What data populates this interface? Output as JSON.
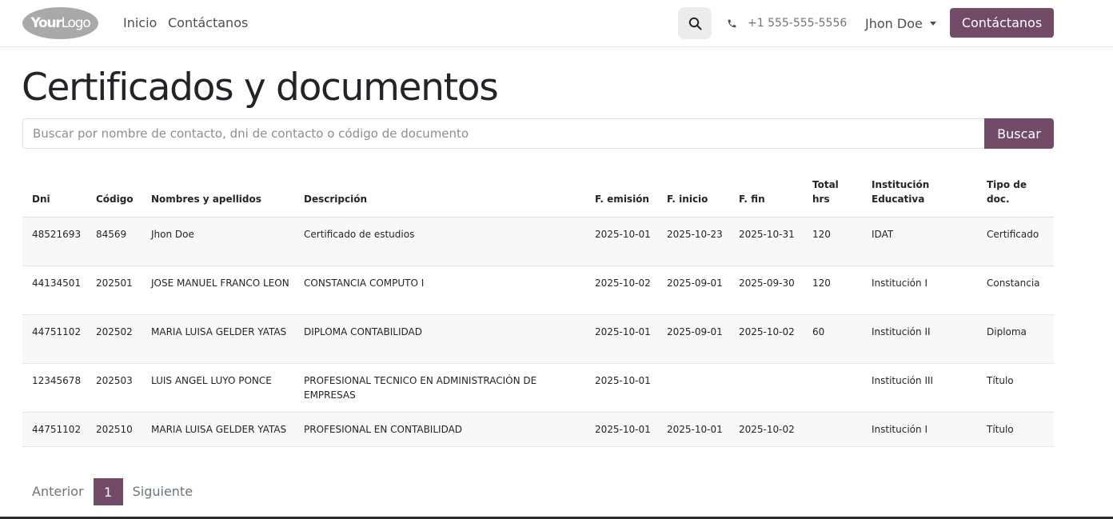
{
  "header": {
    "logo": {
      "text_bold": "Your",
      "text_light": "Logo"
    },
    "nav": {
      "home": "Inicio",
      "contact": "Contáctanos"
    },
    "search_icon": "search-icon",
    "phone": {
      "icon": "phone-icon",
      "number": "+1 555-555-5556"
    },
    "user_name": "Jhon Doe",
    "cta_label": "Contáctanos"
  },
  "page": {
    "title": "Certificados y documentos"
  },
  "search": {
    "placeholder": "Buscar por nombre de contacto, dni de contacto o código de documento",
    "button_label": "Buscar"
  },
  "table": {
    "headers": {
      "dni": "Dni",
      "codigo": "Código",
      "nombres": "Nombres y apellidos",
      "descripcion": "Descripción",
      "f_emision": "F. emisión",
      "f_inicio": "F. inicio",
      "f_fin": "F. fin",
      "total_hrs": "Total hrs",
      "institucion": "Institución Educativa",
      "tipo_doc": "Tipo de doc."
    },
    "rows": [
      {
        "dni": "48521693",
        "codigo": "84569",
        "nombres": "Jhon Doe",
        "descripcion": "Certificado de estudios",
        "f_emision": "2025-10-01",
        "f_inicio": "2025-10-23",
        "f_fin": "2025-10-31",
        "total_hrs": "120",
        "institucion": "IDAT",
        "tipo_doc": "Certificado"
      },
      {
        "dni": "44134501",
        "codigo": "202501",
        "nombres": "JOSE MANUEL FRANCO LEON",
        "descripcion": "CONSTANCIA COMPUTO I",
        "f_emision": "2025-10-02",
        "f_inicio": "2025-09-01",
        "f_fin": "2025-09-30",
        "total_hrs": "120",
        "institucion": "Institución I",
        "tipo_doc": "Constancia"
      },
      {
        "dni": "44751102",
        "codigo": "202502",
        "nombres": "MARIA LUISA GELDER YATAS",
        "descripcion": "DIPLOMA CONTABILIDAD",
        "f_emision": "2025-10-01",
        "f_inicio": "2025-09-01",
        "f_fin": "2025-10-02",
        "total_hrs": "60",
        "institucion": "Institución II",
        "tipo_doc": "Diploma"
      },
      {
        "dni": "12345678",
        "codigo": "202503",
        "nombres": "LUIS ANGEL LUYO PONCE",
        "descripcion": "PROFESIONAL TECNICO EN ADMINISTRACIÓN DE EMPRESAS",
        "f_emision": "2025-10-01",
        "f_inicio": "",
        "f_fin": "",
        "total_hrs": "",
        "institucion": "Institución III",
        "tipo_doc": "Título"
      },
      {
        "dni": "44751102",
        "codigo": "202510",
        "nombres": "MARIA LUISA GELDER YATAS",
        "descripcion": "PROFESIONAL EN CONTABILIDAD",
        "f_emision": "2025-10-01",
        "f_inicio": "2025-10-01",
        "f_fin": "2025-10-02",
        "total_hrs": "",
        "institucion": "Institución I",
        "tipo_doc": "Título"
      }
    ]
  },
  "pagination": {
    "prev": "Anterior",
    "current": "1",
    "next": "Siguiente"
  },
  "colors": {
    "brand": "#714b67",
    "stripe": "#f8f8f8",
    "border": "#dee2e6"
  }
}
